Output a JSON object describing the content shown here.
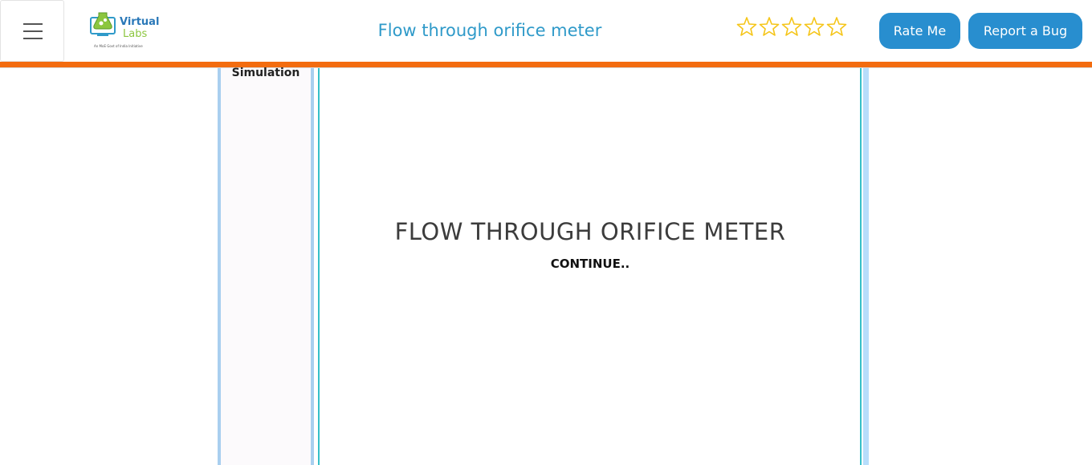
{
  "header": {
    "title": "Flow through orifice meter",
    "logo": {
      "main_text": "Virtual",
      "secondary_text": "Labs",
      "tagline": "An MoE Govt of India Initiative"
    },
    "rating": {
      "stars_total": 5,
      "stars_filled": 0,
      "star_color": "#f5c518"
    },
    "rate_button_label": "Rate Me",
    "report_button_label": "Report a Bug",
    "accent_color": "#f36c0f",
    "button_color": "#288ecf"
  },
  "sidebar": {
    "label": "Simulation"
  },
  "simulation": {
    "title": "FLOW THROUGH ORIFICE METER",
    "continue_label": "CONTINUE.."
  }
}
